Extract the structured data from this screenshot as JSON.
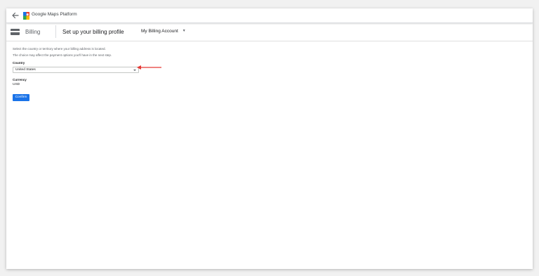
{
  "app": {
    "title": "Google Maps Platform"
  },
  "header": {
    "section_label": "Billing",
    "page_title": "Set up your billing profile",
    "account_label": "My Billing Account"
  },
  "form": {
    "help_line_1": "Select the country or territory where your billing address is located.",
    "help_line_2": "The choice may affect the payment options you'll have in the next step.",
    "country_label": "Country",
    "country_value": "United States",
    "currency_label": "Currency",
    "currency_value": "USD",
    "confirm_label": "Confirm"
  },
  "colors": {
    "accent": "#1a73e8",
    "annotation_arrow": "#e53935"
  },
  "icons": {
    "back": "arrow-back-icon",
    "logo": "maps-logo-icon",
    "billing": "billing-card-icon",
    "dropdown": "chevron-down-icon"
  }
}
